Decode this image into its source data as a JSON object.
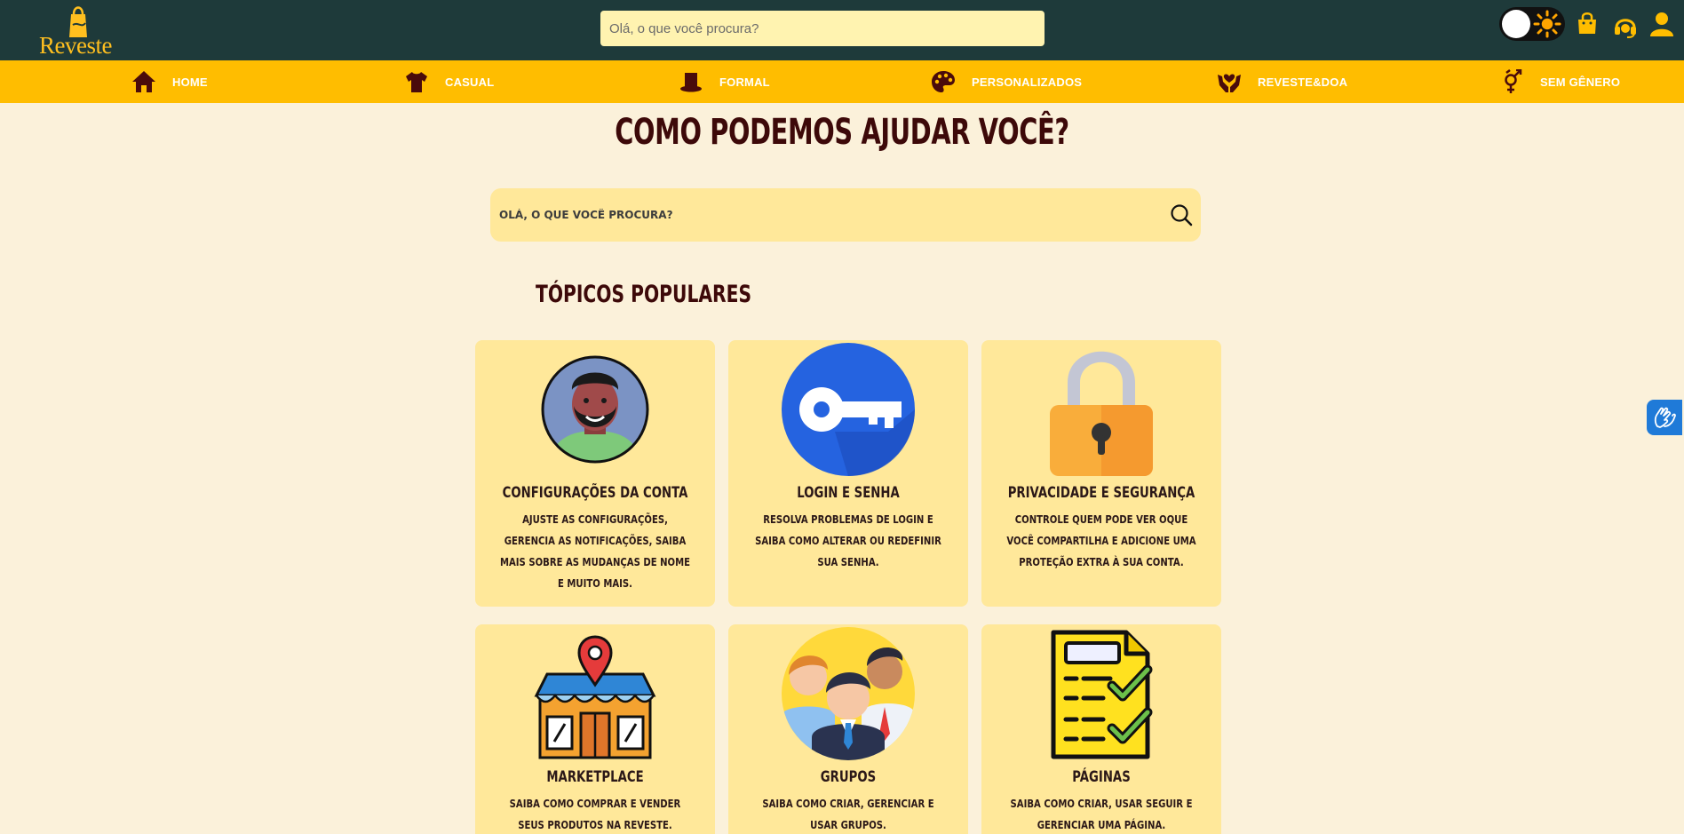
{
  "header": {
    "logo_text": "Reveste",
    "search_placeholder": "Olá, o que você procura?"
  },
  "nav": {
    "items": [
      {
        "label": "HOME",
        "icon": "home-icon"
      },
      {
        "label": "CASUAL",
        "icon": "tshirt-icon"
      },
      {
        "label": "FORMAL",
        "icon": "top-hat-icon"
      },
      {
        "label": "PERSONALIZADOS",
        "icon": "palette-icon"
      },
      {
        "label": "REVESTE&DOA",
        "icon": "hands-heart-icon"
      },
      {
        "label": "SEM GÊNERO",
        "icon": "genderless-icon"
      }
    ]
  },
  "main": {
    "title": "COMO PODEMOS AJUDAR VOCÊ?",
    "search_placeholder": "OLÁ, O QUE VOCÊ PROCURA?",
    "section_title": "TÓPICOS POPULARES"
  },
  "cards": [
    {
      "title": "CONFIGURAÇÕES DA CONTA",
      "desc": "AJUSTE AS CONFIGURAÇÕES, GERENCIA AS NOTIFICAÇÕES, SAIBA MAIS SOBRE AS MUDANÇAS DE NOME E MUITO MAIS.",
      "icon": "user-avatar-icon"
    },
    {
      "title": "LOGIN E SENHA",
      "desc": "RESOLVA PROBLEMAS DE LOGIN E SAIBA COMO ALTERAR OU REDEFINIR SUA SENHA.",
      "icon": "key-icon"
    },
    {
      "title": "PRIVACIDADE E SEGURANÇA",
      "desc": "CONTROLE QUEM PODE VER OQUE VOCÊ COMPARTILHA E ADICIONE UMA PROTEÇÃO EXTRA À SUA CONTA.",
      "icon": "padlock-icon"
    },
    {
      "title": "MARKETPLACE",
      "desc": "SAIBA COMO COMPRAR E VENDER SEUS PRODUTOS NA REVESTE.",
      "icon": "store-icon"
    },
    {
      "title": "GRUPOS",
      "desc": "SAIBA COMO CRIAR, GERENCIAR E USAR GRUPOS.",
      "icon": "group-icon"
    },
    {
      "title": "PÁGINAS",
      "desc": "SAIBA COMO CRIAR, USAR SEGUIR E GERENCIAR UMA PÁGINA.",
      "icon": "checklist-icon"
    }
  ],
  "colors": {
    "topbar": "#1e3a3a",
    "navbar": "#ffbd00",
    "background": "#fbf1da",
    "card": "#ffe89a",
    "title": "#3d0909"
  }
}
